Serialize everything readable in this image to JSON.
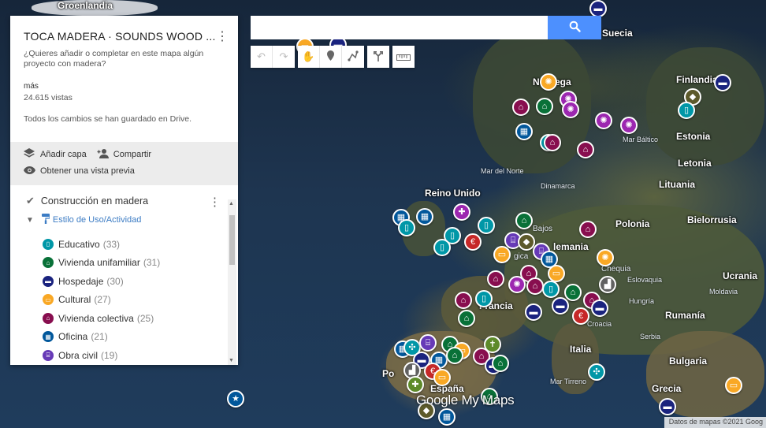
{
  "panel": {
    "title": "TOCA MADERA · SOUNDS WOOD ...",
    "description": "¿Quieres añadir o completar en este mapa algún proyecto con madera?",
    "more": "más",
    "views": "24.615 vistas",
    "saved_status": "Todos los cambios se han guardado en Drive.",
    "actions": {
      "add_layer": "Añadir capa",
      "share": "Compartir",
      "preview": "Obtener una vista previa"
    },
    "layer": {
      "name": "Construcción en madera",
      "style": "Estilo de Uso/Actividad",
      "categories": [
        {
          "label": "Educativo",
          "count": "(33)",
          "color": "#0097a7",
          "icon": "book-icon"
        },
        {
          "label": "Vivienda unifamiliar",
          "count": "(31)",
          "color": "#097138",
          "icon": "house-icon"
        },
        {
          "label": "Hospedaje",
          "count": "(30)",
          "color": "#1a237e",
          "icon": "bed-icon"
        },
        {
          "label": "Cultural",
          "count": "(27)",
          "color": "#f9a825",
          "icon": "ticket-icon"
        },
        {
          "label": "Vivienda colectiva",
          "count": "(25)",
          "color": "#880e4f",
          "icon": "houses-icon"
        },
        {
          "label": "Oficina",
          "count": "(21)",
          "color": "#01579b",
          "icon": "office-icon"
        },
        {
          "label": "Obra civil",
          "count": "(19)",
          "color": "#673ab7",
          "icon": "bridge-icon"
        }
      ]
    }
  },
  "search": {
    "placeholder": "",
    "value": ""
  },
  "map_labels": {
    "groenlandia": "Groenlandia",
    "suecia": "Suecia",
    "noruega": "Noruega",
    "finlandia": "Finlandia",
    "estonia": "Estonia",
    "letonia": "Letonia",
    "lituania": "Lituania",
    "mar_baltico": "Mar Báltico",
    "mar_del_norte": "Mar del Norte",
    "dinamarca": "Dinamarca",
    "reino_unido": "Reino Unido",
    "polonia": "Polonia",
    "bielorrusia": "Bielorrusia",
    "bajos": "Bajos",
    "alemania": "lemania",
    "belgica": "gica",
    "chequia": "Chequia",
    "eslovaquia": "Eslovaquia",
    "ucrania": "Ucrania",
    "hungria": "Hungría",
    "moldavia": "Moldavia",
    "francia": "Francia",
    "rumania": "Rumanía",
    "croacia": "Croacia",
    "serbia": "Serbia",
    "italia": "Italia",
    "bulgaria": "Bulgaria",
    "espana": "España",
    "po": "Po",
    "mar_tirreno": "Mar Tirreno",
    "grecia": "Grecia"
  },
  "logo": "Google My Maps",
  "attribution": "Datos de mapas ©2021 Goog"
}
